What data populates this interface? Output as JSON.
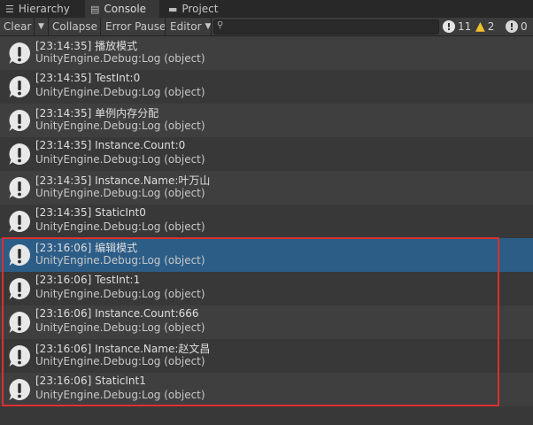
{
  "tabs": [
    {
      "label": "Hierarchy",
      "icon": "hierarchy-icon",
      "active": false
    },
    {
      "label": "Console",
      "icon": "console-icon",
      "active": true
    },
    {
      "label": "Project",
      "icon": "folder-icon",
      "active": false
    }
  ],
  "toolbar": {
    "clear_label": "Clear",
    "collapse_label": "Collapse",
    "error_pause_label": "Error Pause",
    "editor_label": "Editor",
    "search_value": "",
    "log_count": "11",
    "warning_count": "2",
    "error_count": "0"
  },
  "colors": {
    "selected_row": "#2c5d87",
    "highlight_border": "#d9302f",
    "warning": "#f2c12e"
  },
  "entries": [
    {
      "line1": "[23:14:35] 播放模式",
      "line2": "UnityEngine.Debug:Log (object)"
    },
    {
      "line1": "[23:14:35] TestInt:0",
      "line2": "UnityEngine.Debug:Log (object)"
    },
    {
      "line1": "[23:14:35] 单例内存分配",
      "line2": "UnityEngine.Debug:Log (object)"
    },
    {
      "line1": "[23:14:35] Instance.Count:0",
      "line2": "UnityEngine.Debug:Log (object)"
    },
    {
      "line1": "[23:14:35] Instance.Name:叶万山",
      "line2": "UnityEngine.Debug:Log (object)"
    },
    {
      "line1": "[23:14:35] StaticInt0",
      "line2": "UnityEngine.Debug:Log (object)"
    },
    {
      "line1": "[23:16:06] 编辑模式",
      "line2": "UnityEngine.Debug:Log (object)",
      "selected": true
    },
    {
      "line1": "[23:16:06] TestInt:1",
      "line2": "UnityEngine.Debug:Log (object)"
    },
    {
      "line1": "[23:16:06] Instance.Count:666",
      "line2": "UnityEngine.Debug:Log (object)"
    },
    {
      "line1": "[23:16:06] Instance.Name:赵文昌",
      "line2": "UnityEngine.Debug:Log (object)"
    },
    {
      "line1": "[23:16:06] StaticInt1",
      "line2": "UnityEngine.Debug:Log (object)"
    }
  ]
}
